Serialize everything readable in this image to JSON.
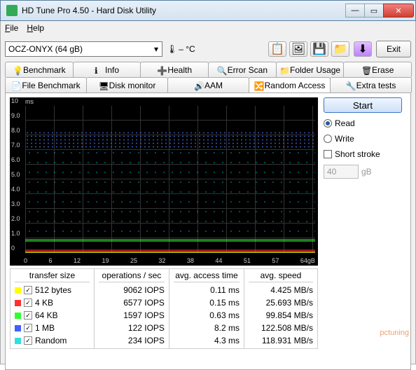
{
  "window": {
    "title": "HD Tune Pro 4.50 - Hard Disk Utility"
  },
  "menubar": {
    "file": "File",
    "help": "Help"
  },
  "toolbar": {
    "drive": "OCZ-ONYX (64 gB)",
    "temp": "– °C",
    "exit": "Exit"
  },
  "tabs_row1": {
    "benchmark": "Benchmark",
    "info": "Info",
    "health": "Health",
    "error_scan": "Error Scan",
    "folder_usage": "Folder Usage",
    "erase": "Erase"
  },
  "tabs_row2": {
    "file_benchmark": "File Benchmark",
    "disk_monitor": "Disk monitor",
    "aam": "AAM",
    "random_access": "Random Access",
    "extra_tests": "Extra tests"
  },
  "right": {
    "start": "Start",
    "read": "Read",
    "write": "Write",
    "short_stroke": "Short stroke",
    "stroke_value": "40",
    "stroke_unit": "gB"
  },
  "graph": {
    "unit": "ms",
    "ylabels": [
      "10",
      "9.0",
      "8.0",
      "7.0",
      "6.0",
      "5.0",
      "4.0",
      "3.0",
      "2.0",
      "1.0",
      "0"
    ],
    "xlabels": [
      "0",
      "6",
      "12",
      "19",
      "25",
      "32",
      "38",
      "44",
      "51",
      "57",
      "64gB"
    ]
  },
  "headers": {
    "transfer": "transfer size",
    "ops": "operations / sec",
    "access": "avg. access time",
    "speed": "avg. speed"
  },
  "rows": [
    {
      "color": "#ffff00",
      "size": "512 bytes",
      "iops": "9062 IOPS",
      "access": "0.11 ms",
      "speed": "4.425 MB/s"
    },
    {
      "color": "#ff3030",
      "size": "4 KB",
      "iops": "6577 IOPS",
      "access": "0.15 ms",
      "speed": "25.693 MB/s"
    },
    {
      "color": "#30ff30",
      "size": "64 KB",
      "iops": "1597 IOPS",
      "access": "0.63 ms",
      "speed": "99.854 MB/s"
    },
    {
      "color": "#4060ff",
      "size": "1 MB",
      "iops": "122 IOPS",
      "access": "8.2 ms",
      "speed": "122.508 MB/s"
    },
    {
      "color": "#30e0e0",
      "size": "Random",
      "iops": "234 IOPS",
      "access": "4.3 ms",
      "speed": "118.931 MB/s"
    }
  ],
  "watermark": "pctuning",
  "chart_data": {
    "type": "scatter",
    "title": "Random Access",
    "xlabel": "gB",
    "ylabel": "ms",
    "xlim": [
      0,
      64
    ],
    "ylim": [
      0,
      10
    ],
    "x_ticks": [
      0,
      6,
      12,
      19,
      25,
      32,
      38,
      44,
      51,
      57,
      64
    ],
    "y_ticks": [
      0,
      1,
      2,
      3,
      4,
      5,
      6,
      7,
      8,
      9,
      10
    ],
    "series": [
      {
        "name": "512 bytes",
        "color": "#ffff00",
        "avg_y": 0.11
      },
      {
        "name": "4 KB",
        "color": "#ff3030",
        "avg_y": 0.15
      },
      {
        "name": "64 KB",
        "color": "#30ff30",
        "avg_y": 0.63
      },
      {
        "name": "1 MB",
        "color": "#4060ff",
        "avg_y": 8.2
      },
      {
        "name": "Random",
        "color": "#30e0e0",
        "avg_y": 4.3
      }
    ]
  }
}
